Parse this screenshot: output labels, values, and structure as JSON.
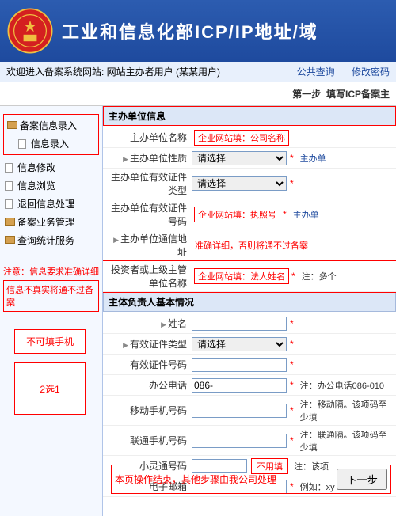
{
  "header": {
    "title": "工业和信息化部ICP/IP地址/域"
  },
  "topbar": {
    "welcome": "欢迎进入备案系统网站: 网站主办者用户 (某某用户)",
    "links": [
      "公共查询",
      "修改密码"
    ]
  },
  "step": {
    "prefix": "第一步",
    "label": "填写ICP备案主"
  },
  "sidebar": {
    "root": "备案信息录入",
    "root_sub": "信息录入",
    "items": [
      "信息修改",
      "信息浏览",
      "退回信息处理"
    ],
    "other": [
      "备案业务管理",
      "查询统计服务"
    ],
    "note1": "注意：信息要求准确详细",
    "note2": "信息不真实将通不过备案"
  },
  "ann": {
    "no_mobile": "不可填手机",
    "two_of_one": "2选1",
    "footer": "本页操作结束，其他步骤由我公司处理",
    "next": "下一步",
    "no_fill": "不用填"
  },
  "sec1": {
    "title": "主办单位信息",
    "rows": [
      {
        "label": "主办单位名称",
        "hint": "企业网站填：公司名称"
      },
      {
        "label": "主办单位性质",
        "select": "请选择",
        "extra": "主办单"
      },
      {
        "label": "主办单位有效证件类型",
        "select": "请选择"
      },
      {
        "label": "主办单位有效证件号码",
        "hint": "企业网站填：执照号",
        "extra": "主办单"
      },
      {
        "label": "主办单位通信地址",
        "hint": "准确详细，否则将通不过备案"
      },
      {
        "label": "投资者或上级主管单位名称",
        "hint": "企业网站填：法人姓名",
        "extra": "注：多个"
      }
    ]
  },
  "sec2": {
    "title": "主体负责人基本情况",
    "rows": [
      {
        "label": "姓名"
      },
      {
        "label": "有效证件类型",
        "select": "请选择"
      },
      {
        "label": "有效证件号码"
      },
      {
        "label": "办公电话",
        "value": "086-",
        "extra": "注：办公电话086-010"
      },
      {
        "label": "移动手机号码",
        "extra": "注：移动隔。该项码至少填"
      },
      {
        "label": "联通手机号码",
        "extra": "注：联通隔。该项码至少填"
      },
      {
        "label": "小灵通号码",
        "extra": "注：该项"
      },
      {
        "label": "电子邮箱",
        "extra": "例如：xy"
      }
    ]
  }
}
